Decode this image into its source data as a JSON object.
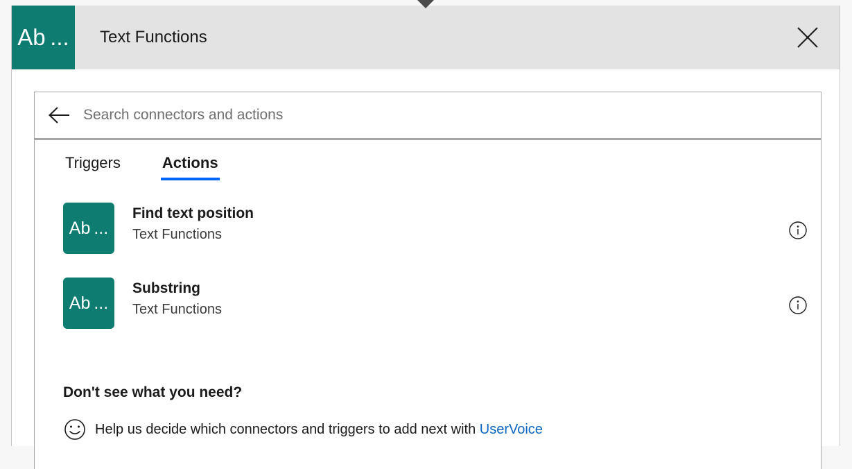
{
  "header": {
    "icon_label": "Ab ...",
    "icon_name": "text-functions-connector-icon",
    "title": "Text Functions",
    "close_label": "✕",
    "bg_color": "#E3E3E3",
    "icon_color": "#0E7C70"
  },
  "search": {
    "back_icon": "back-arrow-icon",
    "placeholder": "Search connectors and actions",
    "value": ""
  },
  "tabs": [
    {
      "label": "Triggers",
      "selected": false
    },
    {
      "label": "Actions",
      "selected": true
    }
  ],
  "accent_color": "#0066FF",
  "actions": [
    {
      "icon_label": "Ab ...",
      "title": "Find text position",
      "subtitle": "Text Functions",
      "info_icon": "info-icon"
    },
    {
      "icon_label": "Ab ...",
      "title": "Substring",
      "subtitle": "Text Functions",
      "info_icon": "info-icon"
    }
  ],
  "footer": {
    "heading": "Don't see what you need?",
    "smiley_icon": "smiley-face-icon",
    "text_before_link": "Help us decide which connectors and triggers to add next with ",
    "link_label": "UserVoice",
    "link_color": "#0A66C2"
  }
}
